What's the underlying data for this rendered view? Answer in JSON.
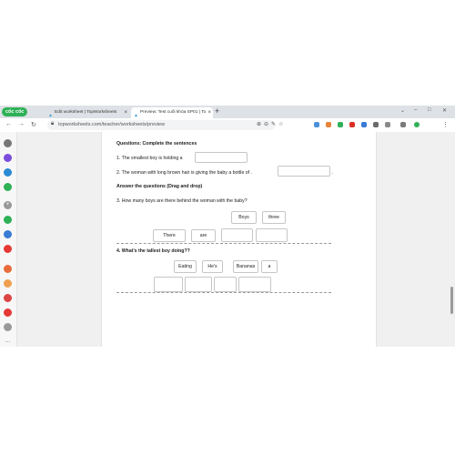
{
  "browser": {
    "brand": "cốc cốc",
    "tabs": [
      {
        "label": "Edit worksheet | TopWorksheets"
      },
      {
        "label": "Preview: Test cuối khóa SP01 | To"
      }
    ],
    "url": "topworksheets.com/teacher/worksheets/preview"
  },
  "worksheet": {
    "section1_title": "Questions: Complete the sentences",
    "q1": "1. The smallest boy is holding a",
    "q2": "2. The woman with long brown hair is giving the baby a bottle of .",
    "q2_end": ".",
    "section2_title": "Answer the questions (Drag and drop)",
    "q3": "3. How many boys are there behind the woman with the baby?",
    "q3_options": [
      "Boys",
      "three"
    ],
    "q3_placed": [
      "There",
      "are"
    ],
    "q4": "4. What's the tallest boy doing??",
    "q4_options": [
      "Eating",
      "He's",
      "Bananas",
      "a"
    ]
  }
}
